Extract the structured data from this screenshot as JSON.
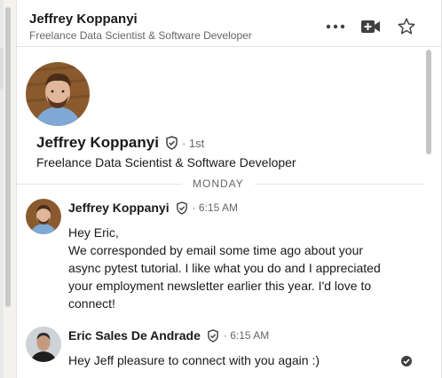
{
  "header": {
    "name": "Jeffrey Koppanyi",
    "headline": "Freelance Data Scientist & Software Developer",
    "icons": [
      "more-options-icon",
      "video-call-icon",
      "star-icon"
    ]
  },
  "profile": {
    "name": "Jeffrey Koppanyi",
    "degree": "· 1st",
    "headline": "Freelance Data Scientist & Software Developer"
  },
  "divider": {
    "label": "MONDAY"
  },
  "messages": [
    {
      "sender": "Jeffrey Koppanyi",
      "time": "· 6:15 AM",
      "text": "Hey Eric,\nWe corresponded by email some time ago about your async pytest tutorial. I like what you do and I appreciated your employment newsletter earlier this year. I'd love to connect!"
    },
    {
      "sender": "Eric Sales De Andrade",
      "time": "· 6:15 AM",
      "text": "Hey Jeff pleasure to connect with you again :)"
    }
  ],
  "colors": {
    "text": "#191919",
    "muted": "#666666",
    "border": "#e4e4e4"
  }
}
